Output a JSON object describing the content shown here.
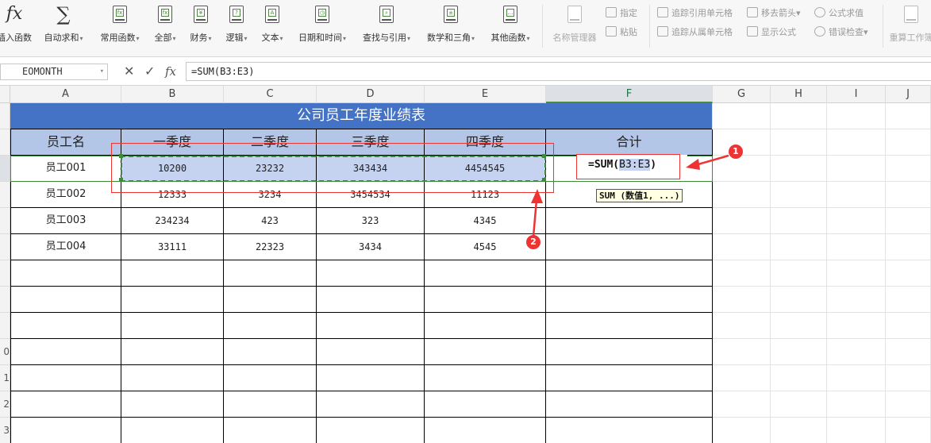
{
  "ribbon": {
    "buttons": [
      {
        "label": "插入函数",
        "dropdown": false,
        "icon": "fx-icon"
      },
      {
        "label": "自动求和",
        "dropdown": true,
        "icon": "sigma-icon"
      },
      {
        "label": "常用函数",
        "dropdown": true,
        "icon": "common-functions-icon"
      },
      {
        "label": "全部",
        "dropdown": true,
        "icon": "all-functions-icon"
      },
      {
        "label": "财务",
        "dropdown": true,
        "icon": "finance-icon"
      },
      {
        "label": "逻辑",
        "dropdown": true,
        "icon": "logic-icon"
      },
      {
        "label": "文本",
        "dropdown": true,
        "icon": "text-icon"
      },
      {
        "label": "日期和时间",
        "dropdown": true,
        "icon": "datetime-icon"
      },
      {
        "label": "查找与引用",
        "dropdown": true,
        "icon": "lookup-icon"
      },
      {
        "label": "数学和三角",
        "dropdown": true,
        "icon": "math-icon"
      },
      {
        "label": "其他函数",
        "dropdown": true,
        "icon": "other-functions-icon"
      },
      {
        "label": "名称管理器",
        "dropdown": false,
        "icon": "name-manager-icon"
      }
    ],
    "small_buttons": [
      {
        "label": "指定",
        "icon": "specify-icon"
      },
      {
        "label": "粘贴",
        "icon": "paste-icon"
      },
      {
        "label": "追踪引用单元格",
        "icon": "trace-precedents-icon"
      },
      {
        "label": "追踪从属单元格",
        "icon": "trace-dependents-icon"
      },
      {
        "label": "移去箭头",
        "icon": "remove-arrows-icon"
      },
      {
        "label": "显示公式",
        "icon": "show-formulas-icon"
      },
      {
        "label": "公式求值",
        "icon": "evaluate-formula-icon"
      },
      {
        "label": "错误检查",
        "icon": "error-check-icon"
      },
      {
        "label": "重算工作簿",
        "icon": "recalc-icon"
      }
    ]
  },
  "formula_bar": {
    "name_box": "EOMONTH",
    "cancel_symbol": "✕",
    "enter_symbol": "✓",
    "fx_symbol": "fx",
    "formula": "=SUM(B3:E3)"
  },
  "columns": [
    "A",
    "B",
    "C",
    "D",
    "E",
    "F",
    "G",
    "H",
    "I",
    "J"
  ],
  "rows": [
    "",
    "",
    "",
    "",
    "",
    "",
    "",
    "",
    "",
    "0",
    "1",
    "2",
    "3"
  ],
  "sheet": {
    "title": "公司员工年度业绩表",
    "headers": [
      "员工名",
      "一季度",
      "二季度",
      "三季度",
      "四季度",
      "合计"
    ],
    "data": [
      [
        "员工001",
        "10200",
        "23232",
        "343434",
        "4454545"
      ],
      [
        "员工002",
        "12333",
        "3234",
        "3454534",
        "11123"
      ],
      [
        "员工003",
        "234234",
        "423",
        "323",
        "4345"
      ],
      [
        "员工004",
        "33111",
        "22323",
        "3434",
        "4545"
      ]
    ],
    "editing_prefix": "=SUM(",
    "editing_ref": "B3:E3",
    "editing_suffix": ")",
    "tooltip": "SUM (数值1, ...)"
  },
  "annotations": {
    "badge1": "1",
    "badge2": "2"
  },
  "colors": {
    "title_bg": "#4472c4",
    "header_bg": "#b4c6e7",
    "selection": "#c5d3f0",
    "annotation_red": "#e33333",
    "marquee_green": "#3d8a3d"
  }
}
